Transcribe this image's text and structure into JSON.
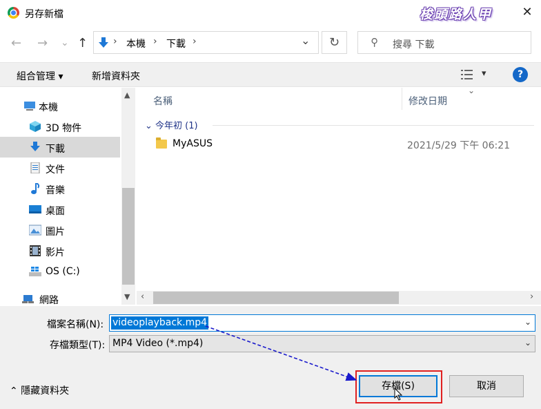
{
  "window": {
    "title": "另存新檔",
    "watermark": "梭頭路人甲",
    "close_glyph": "✕"
  },
  "nav": {
    "back_glyph": "←",
    "forward_glyph": "→",
    "recent_glyph": "⌄",
    "up_glyph": "↑",
    "breadcrumb": [
      "本機",
      "下載"
    ],
    "crumb_sep": "›",
    "dropdown_glyph": "⌄",
    "refresh_glyph": "↻",
    "search_placeholder": "搜尋 下載"
  },
  "toolbar": {
    "organize_label": "組合管理 ▾",
    "new_folder_label": "新增資料夾",
    "view_menu_glyph": "▾",
    "help_glyph": "?"
  },
  "sidebar": {
    "items": [
      {
        "label": "本機",
        "icon": "computer-icon",
        "selected": false
      },
      {
        "label": "3D 物件",
        "icon": "cube-icon",
        "selected": false
      },
      {
        "label": "下載",
        "icon": "download-icon",
        "selected": true
      },
      {
        "label": "文件",
        "icon": "document-icon",
        "selected": false
      },
      {
        "label": "音樂",
        "icon": "music-icon",
        "selected": false
      },
      {
        "label": "桌面",
        "icon": "desktop-icon",
        "selected": false
      },
      {
        "label": "圖片",
        "icon": "picture-icon",
        "selected": false
      },
      {
        "label": "影片",
        "icon": "video-icon",
        "selected": false
      },
      {
        "label": "OS (C:)",
        "icon": "drive-icon",
        "selected": false
      },
      {
        "label": "網路",
        "icon": "network-icon",
        "selected": false
      }
    ]
  },
  "file_list": {
    "col_name": "名稱",
    "col_date": "修改日期",
    "group_label": "⌄ 今年初 (1)",
    "rows": [
      {
        "name": "MyASUS",
        "date": "2021/5/29 下午 06:21",
        "icon": "folder-icon"
      }
    ]
  },
  "form": {
    "filename_label": "檔案名稱(N):",
    "filename_value": "videoplayback.mp4",
    "filetype_label": "存檔類型(T):",
    "filetype_value": "MP4 Video (*.mp4)",
    "chevron_glyph": "⌄"
  },
  "footer": {
    "hide_folders_label": "⌃ 隱藏資料夾",
    "save_label": "存檔(S)",
    "cancel_label": "取消"
  },
  "colors": {
    "accent": "#0078d7",
    "highlight_box": "#e02020",
    "annotation_arrow": "#1a1acc"
  }
}
